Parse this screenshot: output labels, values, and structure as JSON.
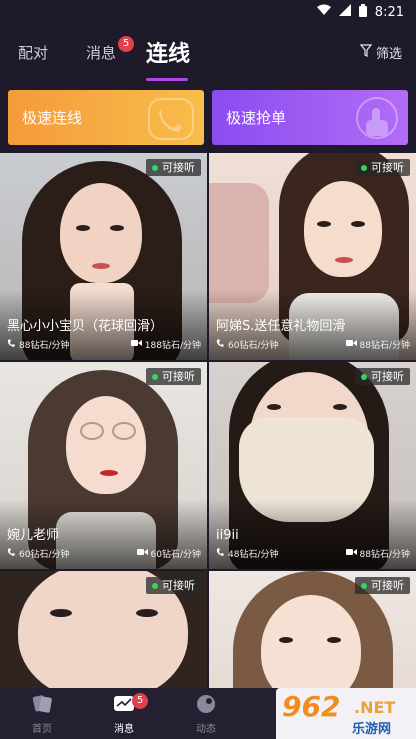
{
  "status_bar": {
    "time": "8:21",
    "icons": [
      "wifi-icon",
      "signal-icon",
      "battery-icon"
    ]
  },
  "header": {
    "tabs": [
      {
        "label": "配对",
        "active": false
      },
      {
        "label": "消息",
        "active": false,
        "badge": "5"
      },
      {
        "label": "连线",
        "active": true
      }
    ],
    "filter_label": "筛选",
    "accent_color": "#b046e8"
  },
  "quick_actions": {
    "connect": {
      "label": "极速连线",
      "icon": "phone-icon"
    },
    "grab": {
      "label": "极速抢单",
      "icon": "tap-hand-icon"
    }
  },
  "hosts": [
    {
      "name": "黑心小小宝贝（花球回滑）",
      "status": "可接听",
      "voice_rate": "88钻石/分钟",
      "video_rate": "188钻石/分钟"
    },
    {
      "name": "阿娣S.送任意礼物回滑",
      "status": "可接听",
      "voice_rate": "60钻石/分钟",
      "video_rate": "88钻石/分钟"
    },
    {
      "name": "婉儿老师",
      "status": "可接听",
      "voice_rate": "60钻石/分钟",
      "video_rate": "60钻石/分钟"
    },
    {
      "name": "ii9ii",
      "status": "可接听",
      "voice_rate": "48钻石/分钟",
      "video_rate": "88钻石/分钟"
    },
    {
      "name": "",
      "status": "可接听",
      "voice_rate": "",
      "video_rate": ""
    },
    {
      "name": "",
      "status": "可接听",
      "voice_rate": "",
      "video_rate": ""
    }
  ],
  "bottom_nav": {
    "items": [
      {
        "label": "首页",
        "icon": "cards-icon"
      },
      {
        "label": "消息",
        "icon": "chat-icon",
        "badge": "5"
      },
      {
        "label": "动态",
        "icon": "moment-icon"
      }
    ]
  },
  "watermark": {
    "number": "962",
    "net": ".NET",
    "sub": "乐游网"
  }
}
